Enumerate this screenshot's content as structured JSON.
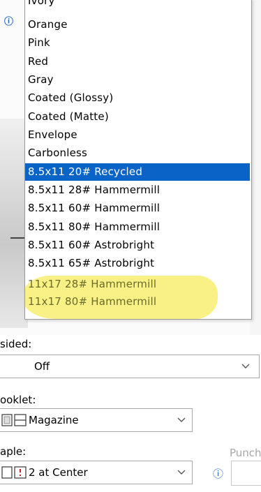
{
  "dropdown": {
    "options": [
      "Ivory",
      "Orange",
      "Pink",
      "Red",
      "Gray",
      "Coated (Glossy)",
      "Coated (Matte)",
      "Envelope",
      "Carbonless",
      "8.5x11 20# Recycled",
      "8.5x11 28# Hammermill",
      "8.5x11 60# Hammermill",
      "8.5x11 80# Hammermill",
      "8.5x11 60# Astrobright",
      "8.5x11 65# Astrobright",
      "11x17 28# Hammermill",
      "11x17 80# Hammermill"
    ],
    "selected": "8.5x11 20# Recycled",
    "highlight_color": "#f8ee70",
    "selection_color": "#0a64c8"
  },
  "settings": {
    "two_sided": {
      "label": "sided:",
      "value": "Off"
    },
    "booklet": {
      "label": "ooklet:",
      "value": "Magazine"
    },
    "staple": {
      "label": "aple:",
      "value": "2 at Center"
    },
    "punch": {
      "label": "Punch"
    }
  },
  "icons": {
    "info": "info-icon",
    "chevron": "chevron-down-icon",
    "booklet": "booklet-icon",
    "staple": "staple-icon"
  }
}
